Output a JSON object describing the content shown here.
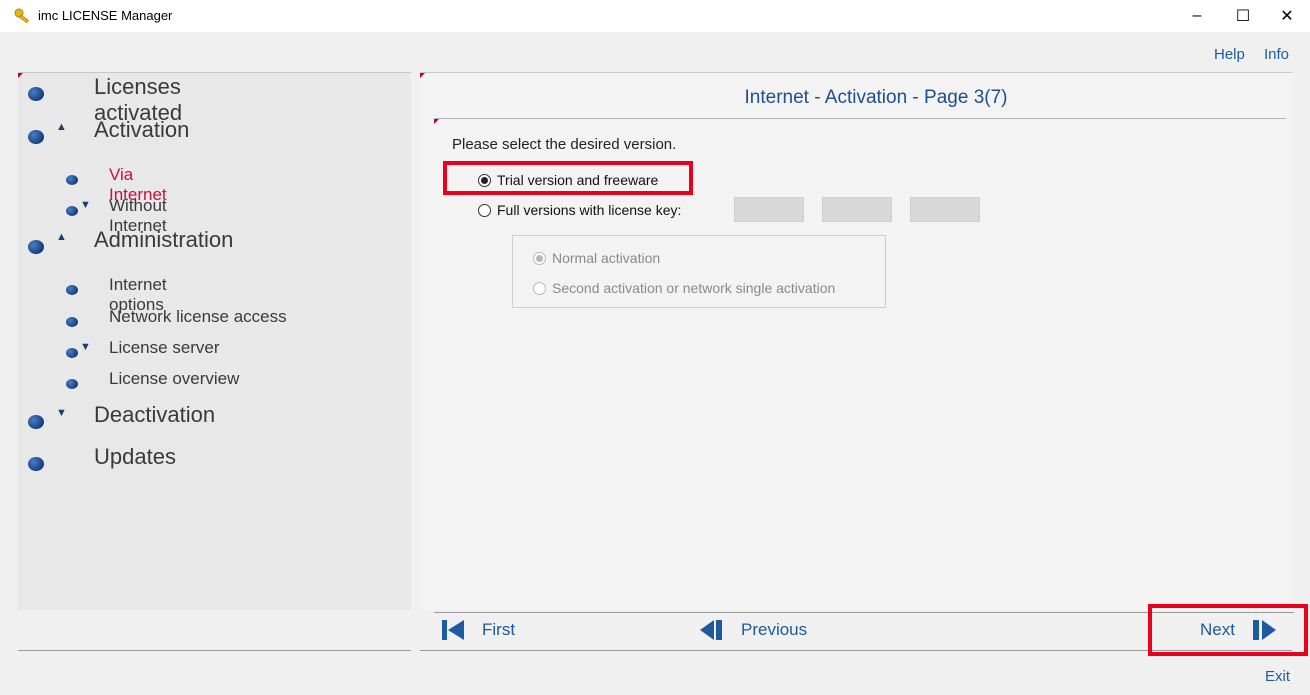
{
  "window": {
    "title": "imc LICENSE Manager",
    "minimize": "–",
    "maximize": "☐",
    "close": "✕"
  },
  "topnav": {
    "help": "Help",
    "info": "Info"
  },
  "sidebar": {
    "items": [
      {
        "label": "Licenses activated"
      },
      {
        "label": "Activation"
      },
      {
        "label": "Via Internet"
      },
      {
        "label": "Without Internet"
      },
      {
        "label": "Administration"
      },
      {
        "label": "Internet options"
      },
      {
        "label": "Network license access"
      },
      {
        "label": "License server"
      },
      {
        "label": "License overview"
      },
      {
        "label": "Deactivation"
      },
      {
        "label": "Updates"
      }
    ]
  },
  "main": {
    "title": "Internet - Activation - Page 3(7)",
    "prompt": "Please select the desired version.",
    "options": {
      "trial": "Trial version and freeware",
      "full": "Full versions with license key:"
    },
    "activation_options": {
      "normal": "Normal activation",
      "second": "Second activation or network single activation"
    }
  },
  "footer": {
    "first": "First",
    "previous": "Previous",
    "next": "Next",
    "exit": "Exit"
  },
  "colors": {
    "accent": "#1e5aa0",
    "selected_nav": "#c8103e",
    "highlight": "#e8001c"
  }
}
